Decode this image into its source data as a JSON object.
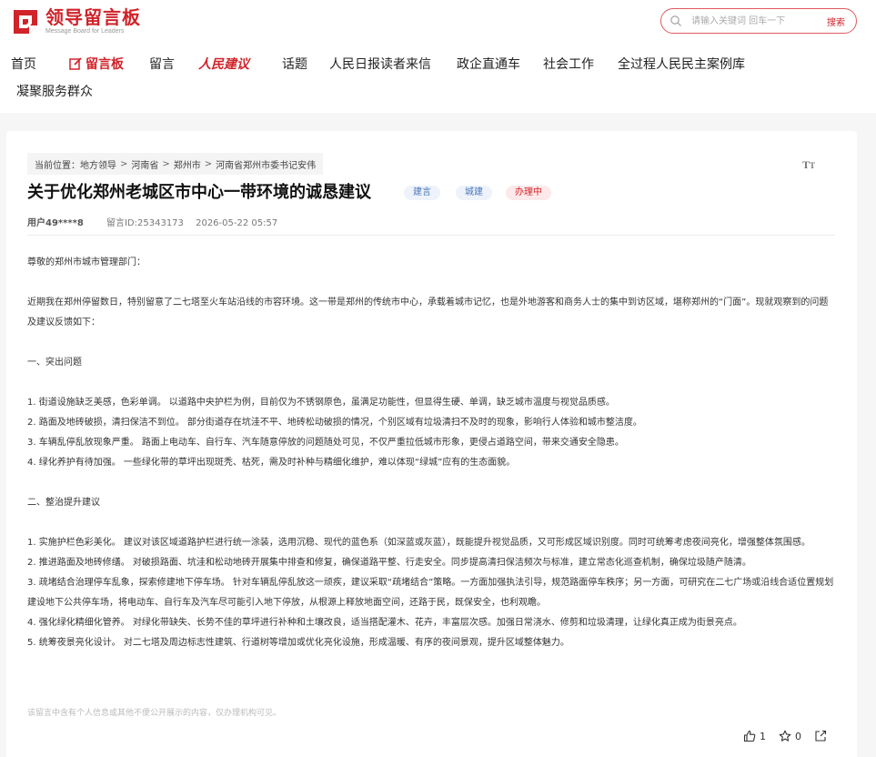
{
  "header": {
    "logo_title": "领导留言板",
    "logo_subtitle": "Message Board for Leaders",
    "search_placeholder": "请输入关键词 回车一下",
    "search_button": "搜索"
  },
  "nav": {
    "home": "首页",
    "brand": "留言板",
    "message": "留言",
    "people_suggest": "人民建议",
    "topics": "话题",
    "reader_letters": "人民日报读者来信",
    "gov_channel": "政企直通车",
    "social_work": "社会工作",
    "democracy_cases": "全过程人民民主案例库",
    "serve_masses": "凝聚服务群众"
  },
  "breadcrumb": {
    "label": "当前位置：",
    "items": [
      "地方领导",
      "河南省",
      "郑州市",
      "河南省郑州市委书记安伟"
    ]
  },
  "post": {
    "title": "关于优化郑州老城区市中心一带环境的诚恳建议",
    "tags": [
      "建言",
      "城建",
      "办理中"
    ],
    "user": "用户49****8",
    "message_id": "留言ID:25343173",
    "datetime": "2026-05-22 05:57",
    "paragraphs": [
      "尊敬的郑州市城市管理部门：",
      "",
      "近期我在郑州停留数日，特别留意了二七塔至火车站沿线的市容环境。这一带是郑州的传统市中心，承载着城市记忆，也是外地游客和商务人士的集中到访区域，堪称郑州的“门面”。现就观察到的问题及建议反馈如下：",
      "",
      "一、突出问题",
      "",
      "1. 街道设施缺乏美感，色彩单调。 以道路中央护栏为例，目前仅为不锈钢原色，虽满足功能性，但显得生硬、单调，缺乏城市温度与视觉品质感。",
      "2. 路面及地砖破损，清扫保洁不到位。 部分街道存在坑洼不平、地砖松动破损的情况，个别区域有垃圾清扫不及时的现象，影响行人体验和城市整洁度。",
      "3. 车辆乱停乱放现象严重。 路面上电动车、自行车、汽车随意停放的问题随处可见，不仅严重拉低城市形象，更侵占道路空间，带来交通安全隐患。",
      "4. 绿化养护有待加强。 一些绿化带的草坪出现斑秃、枯死，需及时补种与精细化维护，难以体现“绿城”应有的生态面貌。",
      "",
      "二、整治提升建议",
      "",
      "1. 实施护栏色彩美化。 建议对该区域道路护栏进行统一涂装，选用沉稳、现代的蓝色系（如深蓝或灰蓝），既能提升视觉品质，又可形成区域识别度。同时可统筹考虑夜间亮化，增强整体氛围感。",
      "2. 推进路面及地砖修缮。 对破损路面、坑洼和松动地砖开展集中排查和修复，确保道路平整、行走安全。同步提高清扫保洁频次与标准，建立常态化巡查机制，确保垃圾随产随清。",
      "3. 疏堵结合治理停车乱象，探索修建地下停车场。 针对车辆乱停乱放这一顽疾，建议采取“疏堵结合”策略。一方面加强执法引导，规范路面停车秩序；另一方面，可研究在二七广场或沿线合适位置规划建设地下公共停车场，将电动车、自行车及汽车尽可能引入地下停放，从根源上释放地面空间，还路于民，既保安全，也利观瞻。",
      "4. 强化绿化精细化管养。 对绿化带缺失、长势不佳的草坪进行补种和土壤改良，适当搭配灌木、花卉，丰富层次感。加强日常浇水、修剪和垃圾清理，让绿化真正成为街景亮点。",
      "5. 统筹夜景亮化设计。 对二七塔及周边标志性建筑、行道树等增加或优化亮化设施，形成温暖、有序的夜间景观，提升区域整体魅力。"
    ],
    "privacy_note": "该留言中含有个人信息或其他不便公开展示的内容，仅办理机构可见。",
    "likes": "1",
    "favorites": "0"
  },
  "colors": {
    "brand_red": "#d0232a",
    "tag_blue": "#4a78b8"
  },
  "icons": [
    "logo-mark-icon",
    "search-icon",
    "font-size-icon",
    "thumbs-up-icon",
    "star-icon",
    "share-icon"
  ]
}
